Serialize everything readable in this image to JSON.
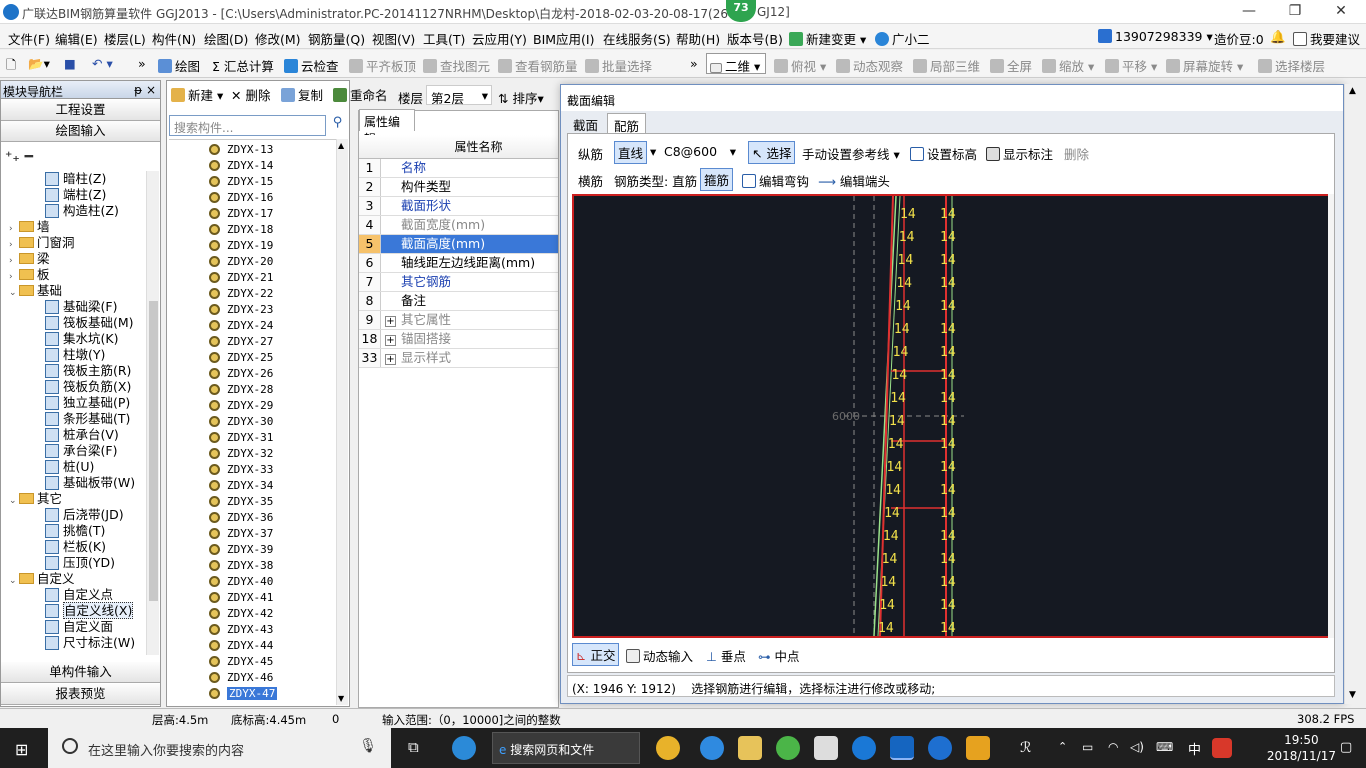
{
  "titlebar": {
    "title": "广联达BIM钢筋算量软件 GGJ2013 - [C:\\Users\\Administrator.PC-20141127NRHM\\Desktop\\白龙村-2018-02-03-20-08-17(260",
    "title_tail": "GJ12]",
    "badge": "73",
    "min": "—",
    "max": "❐",
    "close": "✕"
  },
  "menubar": {
    "items": [
      "文件(F)",
      "编辑(E)",
      "楼层(L)",
      "构件(N)",
      "绘图(D)",
      "修改(M)",
      "钢筋量(Q)",
      "视图(V)",
      "工具(T)",
      "云应用(Y)",
      "BIM应用(I)",
      "在线服务(S)",
      "帮助(H)",
      "版本号(B)",
      "新建变更",
      "广小二"
    ],
    "phone": "13907298339",
    "price": "造价豆:0",
    "feedback": "我要建议"
  },
  "toolbar": {
    "items": [
      "绘图",
      "Σ 汇总计算",
      "云检查",
      "平齐板顶",
      "查找图元",
      "查看钢筋量",
      "批量选择"
    ],
    "view_mode": "二维",
    "right": [
      "俯视",
      "动态观察",
      "局部三维",
      "全屏",
      "缩放",
      "平移",
      "屏幕旋转",
      "选择楼层"
    ]
  },
  "leftnav": {
    "title": "模块导航栏",
    "pin": "ᵽ ×",
    "eng": "工程设置",
    "draw": "绘图输入",
    "single": "单构件输入",
    "report": "报表预览",
    "tree": [
      {
        "label": "暗柱(Z)",
        "indent": 3,
        "type": "item"
      },
      {
        "label": "端柱(Z)",
        "indent": 3,
        "type": "item"
      },
      {
        "label": "构造柱(Z)",
        "indent": 3,
        "type": "item"
      },
      {
        "label": "墙",
        "indent": 1,
        "type": "folder",
        "tog": "›"
      },
      {
        "label": "门窗洞",
        "indent": 1,
        "type": "folder",
        "tog": "›"
      },
      {
        "label": "梁",
        "indent": 1,
        "type": "folder",
        "tog": "›"
      },
      {
        "label": "板",
        "indent": 1,
        "type": "folder",
        "tog": "›"
      },
      {
        "label": "基础",
        "indent": 1,
        "type": "folder",
        "tog": "⌄"
      },
      {
        "label": "基础梁(F)",
        "indent": 3,
        "type": "item"
      },
      {
        "label": "筏板基础(M)",
        "indent": 3,
        "type": "item"
      },
      {
        "label": "集水坑(K)",
        "indent": 3,
        "type": "item"
      },
      {
        "label": "柱墩(Y)",
        "indent": 3,
        "type": "item"
      },
      {
        "label": "筏板主筋(R)",
        "indent": 3,
        "type": "item"
      },
      {
        "label": "筏板负筋(X)",
        "indent": 3,
        "type": "item"
      },
      {
        "label": "独立基础(P)",
        "indent": 3,
        "type": "item"
      },
      {
        "label": "条形基础(T)",
        "indent": 3,
        "type": "item"
      },
      {
        "label": "桩承台(V)",
        "indent": 3,
        "type": "item"
      },
      {
        "label": "承台梁(F)",
        "indent": 3,
        "type": "item"
      },
      {
        "label": "桩(U)",
        "indent": 3,
        "type": "item"
      },
      {
        "label": "基础板带(W)",
        "indent": 3,
        "type": "item"
      },
      {
        "label": "其它",
        "indent": 1,
        "type": "folder",
        "tog": "⌄"
      },
      {
        "label": "后浇带(JD)",
        "indent": 3,
        "type": "item"
      },
      {
        "label": "挑檐(T)",
        "indent": 3,
        "type": "item"
      },
      {
        "label": "栏板(K)",
        "indent": 3,
        "type": "item"
      },
      {
        "label": "压顶(YD)",
        "indent": 3,
        "type": "item"
      },
      {
        "label": "自定义",
        "indent": 1,
        "type": "folder",
        "tog": "⌄"
      },
      {
        "label": "自定义点",
        "indent": 3,
        "type": "item"
      },
      {
        "label": "自定义线(X)",
        "indent": 3,
        "type": "item",
        "sel": true
      },
      {
        "label": "自定义面",
        "indent": 3,
        "type": "item"
      },
      {
        "label": "尺寸标注(W)",
        "indent": 3,
        "type": "item"
      }
    ]
  },
  "comp": {
    "new": "新建",
    "del": "删除",
    "copy": "复制",
    "rename": "重命名",
    "floor_label": "楼层",
    "floor": "第2层",
    "sort": "排序",
    "search_placeholder": "搜索构件...",
    "items": [
      "ZDYX-13",
      "ZDYX-14",
      "ZDYX-15",
      "ZDYX-16",
      "ZDYX-17",
      "ZDYX-18",
      "ZDYX-19",
      "ZDYX-20",
      "ZDYX-21",
      "ZDYX-22",
      "ZDYX-23",
      "ZDYX-24",
      "ZDYX-27",
      "ZDYX-25",
      "ZDYX-26",
      "ZDYX-28",
      "ZDYX-29",
      "ZDYX-30",
      "ZDYX-31",
      "ZDYX-32",
      "ZDYX-33",
      "ZDYX-34",
      "ZDYX-35",
      "ZDYX-36",
      "ZDYX-37",
      "ZDYX-39",
      "ZDYX-38",
      "ZDYX-40",
      "ZDYX-41",
      "ZDYX-42",
      "ZDYX-43",
      "ZDYX-44",
      "ZDYX-45",
      "ZDYX-46",
      "ZDYX-47"
    ],
    "selected": "ZDYX-47"
  },
  "props": {
    "tab": "属性编辑",
    "header": "属性名称",
    "rows": [
      {
        "n": "1",
        "l": "名称",
        "s": "blue"
      },
      {
        "n": "2",
        "l": "构件类型",
        "s": ""
      },
      {
        "n": "3",
        "l": "截面形状",
        "s": "blue"
      },
      {
        "n": "4",
        "l": "截面宽度(mm)",
        "s": "gray"
      },
      {
        "n": "5",
        "l": "截面高度(mm)",
        "s": "sel"
      },
      {
        "n": "6",
        "l": "轴线距左边线距离(mm)",
        "s": ""
      },
      {
        "n": "7",
        "l": "其它钢筋",
        "s": "blue"
      },
      {
        "n": "8",
        "l": "备注",
        "s": ""
      },
      {
        "n": "9",
        "l": "其它属性",
        "s": "gray",
        "exp": "+"
      },
      {
        "n": "18",
        "l": "锚固搭接",
        "s": "gray",
        "exp": "+"
      },
      {
        "n": "33",
        "l": "显示样式",
        "s": "gray",
        "exp": "+"
      }
    ]
  },
  "dialog": {
    "title": "截面编辑",
    "tab1": "截面",
    "tab2": "配筋",
    "row1": {
      "zong": "纵筋",
      "line": "直线",
      "spec": "C8@600",
      "select": "选择",
      "manual": "手动设置参考线",
      "elev": "设置标高",
      "show": "显示标注",
      "del": "删除"
    },
    "row2": {
      "heng": "横筋",
      "type": "钢筋类型: 直筋",
      "gu": "箍筋",
      "bend": "编辑弯钩",
      "end": "编辑端头"
    },
    "canvas": {
      "dim": "6000",
      "rebar_label": "14"
    },
    "bottom": {
      "ortho": "正交",
      "dyn": "动态输入",
      "perp": "垂点",
      "mid": "中点"
    },
    "status": {
      "coord": "(X: 1946 Y: 1912)",
      "msg": "选择钢筋进行编辑，选择标注进行修改或移动;"
    }
  },
  "statusbar": {
    "floor_h": "层高:4.5m",
    "bottom_h": "底标高:4.45m",
    "zero": "0",
    "range": "输入范围:（0，10000]之间的整数",
    "fps": "308.2 FPS"
  },
  "taskbar": {
    "search": "在这里输入你要搜索的内容",
    "web": "搜索网页和文件",
    "time": "19:50",
    "date": "2018/11/17",
    "ime": "中"
  },
  "colors": {
    "accent": "#3a78d8",
    "canvas_bg": "#151922",
    "canvas_border": "#cc2020",
    "rebar_red": "#e03030",
    "rebar_text": "#f2e04a",
    "rebar_green": "#9be28a"
  }
}
